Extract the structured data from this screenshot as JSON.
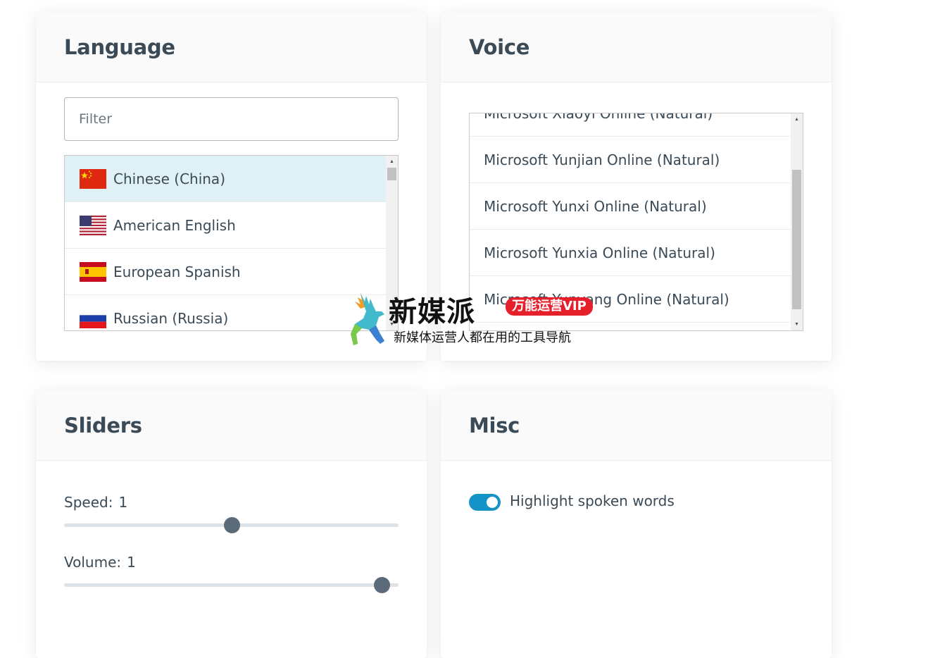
{
  "language": {
    "title": "Language",
    "filter_placeholder": "Filter",
    "items": [
      {
        "label": "Chinese (China)",
        "flag": "cn-flag-icon",
        "selected": true
      },
      {
        "label": "American English",
        "flag": "us-flag-icon",
        "selected": false
      },
      {
        "label": "European Spanish",
        "flag": "es-flag-icon",
        "selected": false
      },
      {
        "label": "Russian (Russia)",
        "flag": "ru-flag-icon",
        "selected": false
      }
    ]
  },
  "voice": {
    "title": "Voice",
    "items": [
      {
        "label": "Microsoft Xiaoyi Online (Natural)"
      },
      {
        "label": "Microsoft Yunjian Online (Natural)"
      },
      {
        "label": "Microsoft Yunxi Online (Natural)"
      },
      {
        "label": "Microsoft Yunxia Online (Natural)"
      },
      {
        "label": "Microsoft Yunyang Online (Natural)"
      }
    ]
  },
  "sliders": {
    "title": "Sliders",
    "speed": {
      "label": "Speed:",
      "value": "1",
      "fraction": 0.5
    },
    "volume": {
      "label": "Volume:",
      "value": "1",
      "fraction": 1.0
    }
  },
  "misc": {
    "title": "Misc",
    "highlight": {
      "label": "Highlight spoken words",
      "on": true
    }
  },
  "watermark": {
    "title": "新媒派",
    "badge": "万能运营VIP",
    "subtitle": "新媒体运营人都在用的工具导航"
  },
  "colors": {
    "accent": "#1593c6",
    "selected_row": "#e0f1f5",
    "slider_thumb": "#5a6a78"
  }
}
